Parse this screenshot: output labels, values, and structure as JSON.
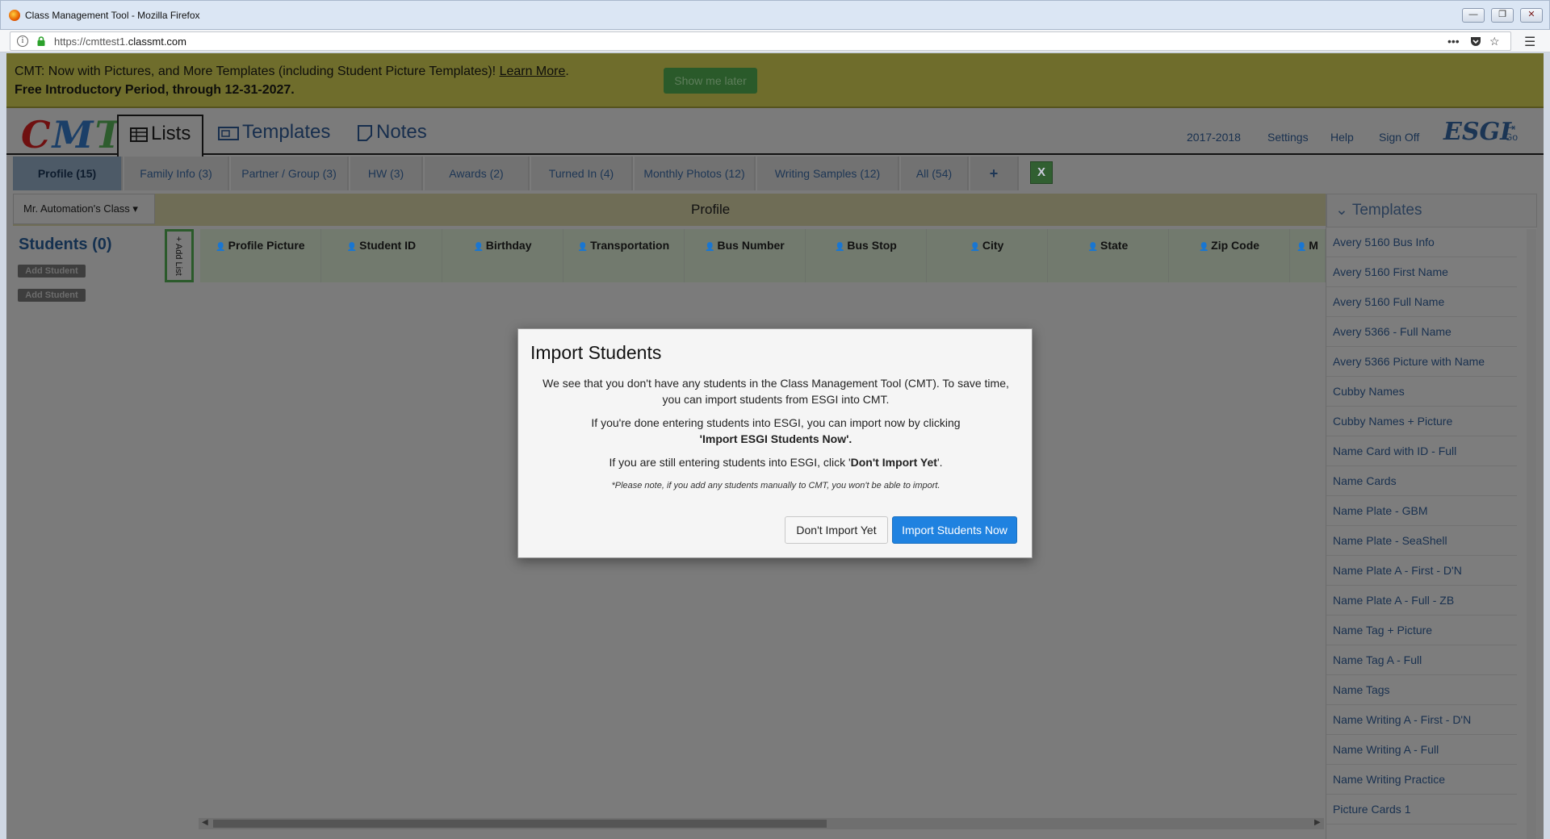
{
  "browser": {
    "window_title": "Class Management Tool - Mozilla Firefox",
    "url_prefix": "https://cmttest1.",
    "url_domain": "classmt.com",
    "controls": {
      "minimize": "—",
      "restore": "❐",
      "close": "✕"
    }
  },
  "banner": {
    "line1": "CMT: Now with Pictures, and More Templates (including Student Picture Templates)!",
    "learn_more": "Learn More",
    "line1_end": ".",
    "line2": "Free Introductory Period, through 12-31-2027.",
    "show_later": "Show me later"
  },
  "header": {
    "logo": {
      "c": "C",
      "m": "M",
      "t": "T"
    },
    "tabs": {
      "lists": "Lists",
      "templates": "Templates",
      "notes": "Notes"
    },
    "links": {
      "year": "2017-2018",
      "settings": "Settings",
      "help": "Help",
      "sign_off": "Sign Off"
    },
    "esgi": "ESGI",
    "go": "Go"
  },
  "list_tabs": [
    "Profile (15)",
    "Family Info (3)",
    "Partner / Group (3)",
    "HW (3)",
    "Awards (2)",
    "Turned In (4)",
    "Monthly Photos (12)",
    "Writing Samples (12)",
    "All (54)"
  ],
  "list_tab_add": "+",
  "subbar": {
    "class_select": "Mr. Automation's Class",
    "page_title": "Profile"
  },
  "students": {
    "title": "Students (0)",
    "add_student": "Add Student",
    "add_list": "+ Add List"
  },
  "columns": [
    "Profile Picture",
    "Student ID",
    "Birthday",
    "Transportation",
    "Bus Number",
    "Bus Stop",
    "City",
    "State",
    "Zip Code",
    "M"
  ],
  "templates_panel": {
    "title": "Templates",
    "items": [
      "Avery 5160 Bus Info",
      "Avery 5160 First Name",
      "Avery 5160 Full Name",
      "Avery 5366 - Full Name",
      "Avery 5366 Picture with Name",
      "Cubby Names",
      "Cubby Names + Picture",
      "Name Card with ID - Full",
      "Name Cards",
      "Name Plate - GBM",
      "Name Plate - SeaShell",
      "Name Plate A - First - D'N",
      "Name Plate A - Full - ZB",
      "Name Tag + Picture",
      "Name Tag A - Full",
      "Name Tags",
      "Name Writing A - First - D'N",
      "Name Writing A - Full",
      "Name Writing Practice",
      "Picture Cards 1"
    ]
  },
  "modal": {
    "title": "Import Students",
    "p1": "We see that you don't have any students in the Class Management Tool (CMT). To save time, you can import students from ESGI into CMT.",
    "p2_a": "If you're done entering students into ESGI, you can import now by clicking",
    "p2_b": "'Import ESGI Students Now'.",
    "p3_a": "If you are still entering students into ESGI, click '",
    "p3_b": "Don't Import Yet",
    "p3_c": "'.",
    "note": "*Please note, if you add any students manually to CMT, you won't be able to import.",
    "btn_no": "Don't Import Yet",
    "btn_yes": "Import Students Now"
  },
  "colors": {
    "primary": "#1f82e0",
    "overlay": "#7b7b7b",
    "banner": "#6f6d2c"
  }
}
